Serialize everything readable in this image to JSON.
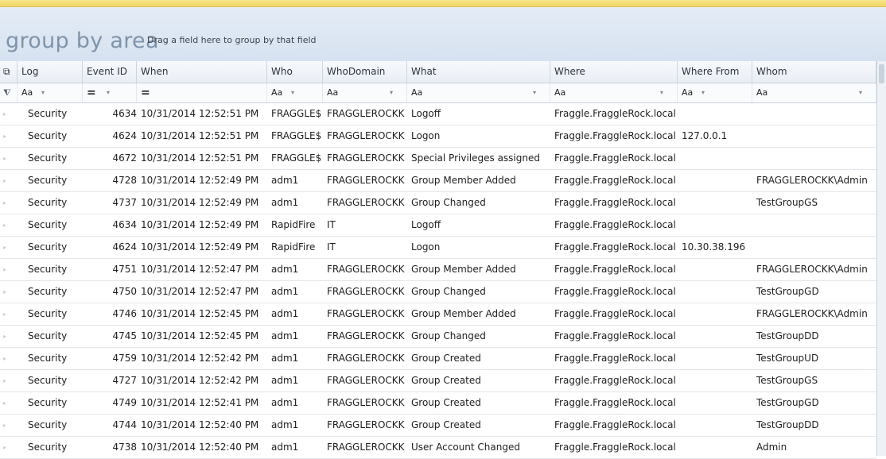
{
  "group_by": {
    "title": "group by area",
    "hint": "Drag a field here to group by that field"
  },
  "columns": [
    {
      "label": "Log",
      "filter": "Aa"
    },
    {
      "label": "Event ID",
      "filter": "="
    },
    {
      "label": "When",
      "filter": "="
    },
    {
      "label": "Who",
      "filter": "Aa"
    },
    {
      "label": "WhoDomain",
      "filter": "Aa"
    },
    {
      "label": "What",
      "filter": "Aa"
    },
    {
      "label": "Where",
      "filter": "Aa"
    },
    {
      "label": "Where From",
      "filter": "Aa"
    },
    {
      "label": "Whom",
      "filter": "Aa"
    }
  ],
  "rows": [
    [
      "Security",
      "4634",
      "10/31/2014 12:52:51 PM",
      "FRAGGLE$",
      "FRAGGLEROCKK",
      "Logoff",
      "Fraggle.FraggleRock.local",
      "",
      ""
    ],
    [
      "Security",
      "4624",
      "10/31/2014 12:52:51 PM",
      "FRAGGLE$",
      "FRAGGLEROCKK",
      "Logon",
      "Fraggle.FraggleRock.local",
      "127.0.0.1",
      ""
    ],
    [
      "Security",
      "4672",
      "10/31/2014 12:52:51 PM",
      "FRAGGLE$",
      "FRAGGLEROCKK",
      "Special Privileges assigned",
      "Fraggle.FraggleRock.local",
      "",
      ""
    ],
    [
      "Security",
      "4728",
      "10/31/2014 12:52:49 PM",
      "adm1",
      "FRAGGLEROCKK",
      "Group Member Added",
      "Fraggle.FraggleRock.local",
      "",
      "FRAGGLEROCKK\\Admin"
    ],
    [
      "Security",
      "4737",
      "10/31/2014 12:52:49 PM",
      "adm1",
      "FRAGGLEROCKK",
      "Group Changed",
      "Fraggle.FraggleRock.local",
      "",
      "TestGroupGS"
    ],
    [
      "Security",
      "4634",
      "10/31/2014 12:52:49 PM",
      "RapidFire",
      "IT",
      "Logoff",
      "Fraggle.FraggleRock.local",
      "",
      ""
    ],
    [
      "Security",
      "4624",
      "10/31/2014 12:52:49 PM",
      "RapidFire",
      "IT",
      "Logon",
      "Fraggle.FraggleRock.local",
      "10.30.38.196",
      ""
    ],
    [
      "Security",
      "4751",
      "10/31/2014 12:52:47 PM",
      "adm1",
      "FRAGGLEROCKK",
      "Group Member Added",
      "Fraggle.FraggleRock.local",
      "",
      "FRAGGLEROCKK\\Admin"
    ],
    [
      "Security",
      "4750",
      "10/31/2014 12:52:47 PM",
      "adm1",
      "FRAGGLEROCKK",
      "Group Changed",
      "Fraggle.FraggleRock.local",
      "",
      "TestGroupGD"
    ],
    [
      "Security",
      "4746",
      "10/31/2014 12:52:45 PM",
      "adm1",
      "FRAGGLEROCKK",
      "Group Member Added",
      "Fraggle.FraggleRock.local",
      "",
      "FRAGGLEROCKK\\Admin"
    ],
    [
      "Security",
      "4745",
      "10/31/2014 12:52:45 PM",
      "adm1",
      "FRAGGLEROCKK",
      "Group Changed",
      "Fraggle.FraggleRock.local",
      "",
      "TestGroupDD"
    ],
    [
      "Security",
      "4759",
      "10/31/2014 12:52:42 PM",
      "adm1",
      "FRAGGLEROCKK",
      "Group Created",
      "Fraggle.FraggleRock.local",
      "",
      "TestGroupUD"
    ],
    [
      "Security",
      "4727",
      "10/31/2014 12:52:42 PM",
      "adm1",
      "FRAGGLEROCKK",
      "Group Created",
      "Fraggle.FraggleRock.local",
      "",
      "TestGroupGS"
    ],
    [
      "Security",
      "4749",
      "10/31/2014 12:52:41 PM",
      "adm1",
      "FRAGGLEROCKK",
      "Group Created",
      "Fraggle.FraggleRock.local",
      "",
      "TestGroupGD"
    ],
    [
      "Security",
      "4744",
      "10/31/2014 12:52:40 PM",
      "adm1",
      "FRAGGLEROCKK",
      "Group Created",
      "Fraggle.FraggleRock.local",
      "",
      "TestGroupDD"
    ],
    [
      "Security",
      "4738",
      "10/31/2014 12:52:40 PM",
      "adm1",
      "FRAGGLEROCKK",
      "User Account Changed",
      "Fraggle.FraggleRock.local",
      "",
      "Admin"
    ]
  ],
  "icons": {
    "column_chooser": "column-chooser-icon",
    "filter_row": "filter-icon",
    "dropdown": "chevron-down-icon",
    "row_indicator": "row-indicator-icon"
  }
}
